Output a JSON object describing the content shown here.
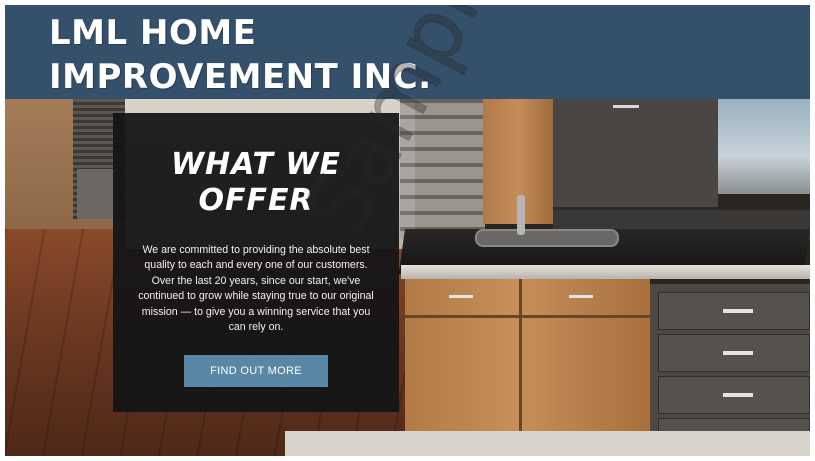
{
  "header": {
    "brand_line1": "LML HOME",
    "brand_line2": "IMPROVEMENT INC.",
    "background_color": "#34506a"
  },
  "offer": {
    "title_line1": "WHAT WE",
    "title_line2": "OFFER",
    "description": "We are committed to providing the absolute best quality to each and every one of our customers. Over the last 20 years, since our start, we've continued to grow while staying true to our original mission — to give you a winning service that you can rely on.",
    "button_label": "FIND OUT MORE",
    "button_color": "#5b87a6",
    "card_color": "#141416"
  },
  "hero": {
    "image_subject": "kitchen-interior"
  },
  "watermark": {
    "text": "Sample Pages"
  }
}
